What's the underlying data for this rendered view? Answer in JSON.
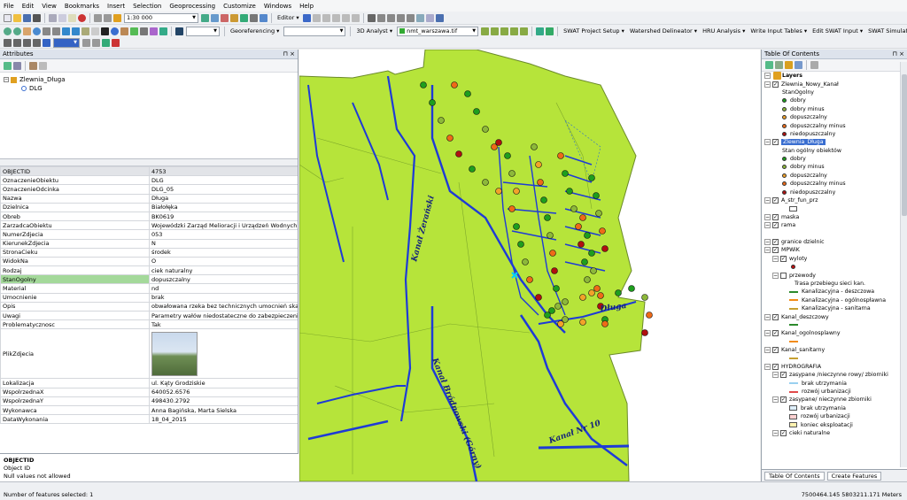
{
  "menu": [
    "File",
    "Edit",
    "View",
    "Bookmarks",
    "Insert",
    "Selection",
    "Geoprocessing",
    "Customize",
    "Windows",
    "Help"
  ],
  "toolbar": {
    "scale": "1:30 000",
    "editor_label": "Editor",
    "georeferencing_label": "Georeferencing",
    "analyst_label": "3D Analyst",
    "raster_layer": "nmt_warszawa.tif",
    "swat_menus": [
      "SWAT Project Setup",
      "Watershed Delineator",
      "HRU Analysis",
      "Write Input Tables",
      "Edit SWAT Input",
      "SWAT Simulation"
    ]
  },
  "attributes": {
    "title": "Attributes",
    "tree": {
      "layer": "Zlewnia_Długa",
      "feature": "DLG"
    },
    "rows": [
      {
        "field": "OBJECTID",
        "value": "4753"
      },
      {
        "field": "OznaczenieObiektu",
        "value": "DLG"
      },
      {
        "field": "OznaczenieOdcinka",
        "value": "DLG_05"
      },
      {
        "field": "Nazwa",
        "value": "Długa"
      },
      {
        "field": "Dzielnica",
        "value": "Białołęka"
      },
      {
        "field": "Obreb",
        "value": "BK0619"
      },
      {
        "field": "ZarzadcaObiektu",
        "value": "Wojewódzki Zarząd Melioracji i Urządzeń Wodnych"
      },
      {
        "field": "NumerZdjecia",
        "value": "053"
      },
      {
        "field": "KierunekZdjecia",
        "value": "N"
      },
      {
        "field": "StronaCieku",
        "value": "środek"
      },
      {
        "field": "WidokNa",
        "value": "O"
      },
      {
        "field": "Rodzaj",
        "value": "ciek naturalny"
      },
      {
        "field": "StanOgolny",
        "value": "dopuszczalny"
      },
      {
        "field": "Material",
        "value": "nd"
      },
      {
        "field": "Umocnienie",
        "value": "brak"
      },
      {
        "field": "Opis",
        "value": "obwałowana rzeka bez technicznych umocnień skarp"
      },
      {
        "field": "Uwagi",
        "value": "Parametry wałów niedostateczne do zabezpieczenia nowopo"
      },
      {
        "field": "Problematycznosc",
        "value": "Tak"
      }
    ],
    "photo_field": "PlikZdjecia",
    "rows_after": [
      {
        "field": "Lokalizacja",
        "value": "ul. Kąty Grodziskie"
      },
      {
        "field": "WspolrzednaX",
        "value": "640052.6576"
      },
      {
        "field": "WspolrzednaY",
        "value": "498430.2792"
      },
      {
        "field": "Wykonawca",
        "value": "Anna Bagińska, Marta Sielska"
      },
      {
        "field": "DataWykonania",
        "value": "18_04_2015"
      }
    ],
    "info": {
      "title": "OBJECTID",
      "line1": "Object ID",
      "line2": "Null values not allowed"
    }
  },
  "map": {
    "labels": [
      "Kanał Żerański",
      "Kanał Bródnowski (Górny)",
      "Kanał Nr 10",
      "Długa"
    ],
    "colors": {
      "terrain": "#b6e43a",
      "water": "#1e3bd6",
      "dobry": "#1e9e1e",
      "dobry_minus": "#8db83a",
      "dopuszczalny": "#f2a22a",
      "dopuszczalny_minus": "#ee6a18",
      "niedopuszczalny": "#b01010"
    }
  },
  "toc": {
    "title": "Table Of Contents",
    "items": [
      {
        "t": "root",
        "label": "Layers"
      },
      {
        "t": "layer",
        "label": "Zlewnia_Nowy_Kanał",
        "checked": true
      },
      {
        "t": "sub",
        "label": "StanOgolny"
      },
      {
        "t": "dot",
        "label": "dobry",
        "color": "#1e9e1e"
      },
      {
        "t": "dot",
        "label": "dobry minus",
        "color": "#8db83a"
      },
      {
        "t": "dot",
        "label": "dopuszczalny",
        "color": "#f2a22a"
      },
      {
        "t": "dot",
        "label": "dopuszczalny minus",
        "color": "#ee6a18"
      },
      {
        "t": "dot",
        "label": "niedopuszczalny",
        "color": "#b01010"
      },
      {
        "t": "layer-sel",
        "label": "Zlewnia_Długa",
        "checked": true
      },
      {
        "t": "sub",
        "label": "Stan ogólny obiektów"
      },
      {
        "t": "dot",
        "label": "dobry",
        "color": "#1e9e1e"
      },
      {
        "t": "dot",
        "label": "dobry minus",
        "color": "#8db83a"
      },
      {
        "t": "dot",
        "label": "dopuszczalny",
        "color": "#f2a22a"
      },
      {
        "t": "dot",
        "label": "dopuszczalny minus",
        "color": "#ee6a18"
      },
      {
        "t": "dot",
        "label": "niedopuszczalny",
        "color": "#b01010"
      },
      {
        "t": "layer",
        "label": "A_str_fun_prz",
        "checked": true
      },
      {
        "t": "box",
        "label": "",
        "color": "#ffffff"
      },
      {
        "t": "layer",
        "label": "maska",
        "checked": true
      },
      {
        "t": "layer",
        "label": "rama",
        "checked": true
      },
      {
        "t": "blank",
        "label": ""
      },
      {
        "t": "layer",
        "label": "granice dzielnic",
        "checked": true
      },
      {
        "t": "group",
        "label": "MPWiK",
        "checked": true
      },
      {
        "t": "layer2",
        "label": "wyloty",
        "checked": true
      },
      {
        "t": "dot2",
        "label": "",
        "color": "#c01010"
      },
      {
        "t": "layer2",
        "label": "przewody",
        "checked": false
      },
      {
        "t": "sub2",
        "label": "Trasa przebiegu sieci kan."
      },
      {
        "t": "line",
        "label": "Kanalizacyjna - deszczowa",
        "color": "#2c8a2c"
      },
      {
        "t": "line",
        "label": "Kanalizacyjna - ogólnospławna",
        "color": "#f28b18"
      },
      {
        "t": "line",
        "label": "Kanalizacyjna - sanitarna",
        "color": "#c6a030"
      },
      {
        "t": "layer",
        "label": "Kanal_deszczowy",
        "checked": true
      },
      {
        "t": "line",
        "label": "",
        "color": "#2c8a2c"
      },
      {
        "t": "layer",
        "label": "Kanal_ogolnosplawny",
        "checked": true
      },
      {
        "t": "line",
        "label": "",
        "color": "#f28b18"
      },
      {
        "t": "layer",
        "label": "Kanal_sanitarny",
        "checked": true
      },
      {
        "t": "line",
        "label": "",
        "color": "#c6a030"
      },
      {
        "t": "group",
        "label": "HYDROGRAFIA",
        "checked": true
      },
      {
        "t": "layer2",
        "label": "zasypane /nieczynne rowy/ zbiorniki",
        "checked": true
      },
      {
        "t": "line",
        "label": "brak utrzymania",
        "color": "#9ad0f0"
      },
      {
        "t": "line",
        "label": "rozwój urbanizacji",
        "color": "#e04a4a"
      },
      {
        "t": "layer2",
        "label": "zasypane/ nieczynne zbiorniki",
        "checked": true
      },
      {
        "t": "box",
        "label": "brak utrzymania",
        "color": "#dff0ff"
      },
      {
        "t": "box",
        "label": "rozwój urbanizacji",
        "color": "#ffd0d0"
      },
      {
        "t": "box",
        "label": "koniec eksploatacji",
        "color": "#fff2b0"
      },
      {
        "t": "layer2",
        "label": "cieki naturalne",
        "checked": true
      }
    ],
    "tabs": [
      "Table Of Contents",
      "Create Features"
    ]
  },
  "status": {
    "selected": "Number of features selected: 1",
    "coords": "7500464.145  5803211.171 Meters"
  }
}
